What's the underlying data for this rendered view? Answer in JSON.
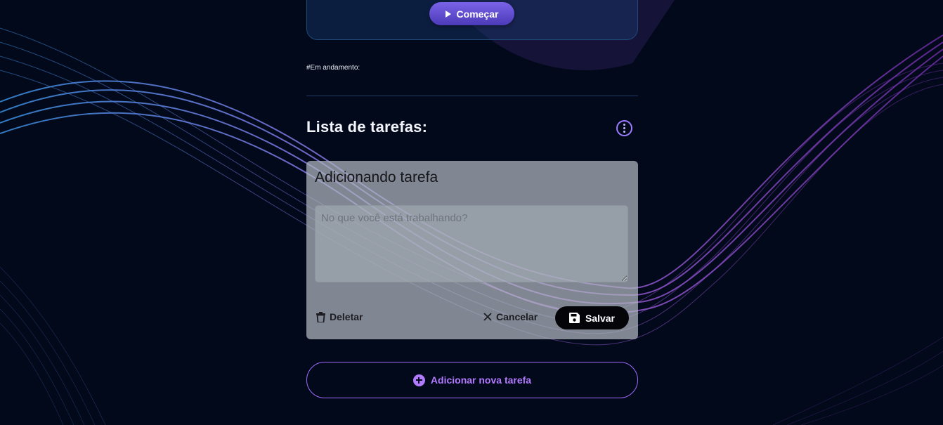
{
  "timer": {
    "start_label": "Começar"
  },
  "status": {
    "label": "#Em andamento:"
  },
  "task_list": {
    "title": "Lista de tarefas:",
    "form": {
      "heading": "Adicionando tarefa",
      "placeholder": "No que você está trabalhando?",
      "delete_label": "Deletar",
      "cancel_label": "Cancelar",
      "save_label": "Salvar"
    },
    "add_label": "Adicionar nova tarefa"
  },
  "icons": {
    "start": "play-icon",
    "more": "vertical-dots-icon",
    "delete": "trash-icon",
    "cancel": "close-icon",
    "save": "floppy-disk-icon",
    "add": "plus-circle-icon"
  },
  "colors": {
    "background": "#02091a",
    "accent": "#b27bff",
    "start_button": "#6a56d8",
    "save_button": "#050509"
  }
}
